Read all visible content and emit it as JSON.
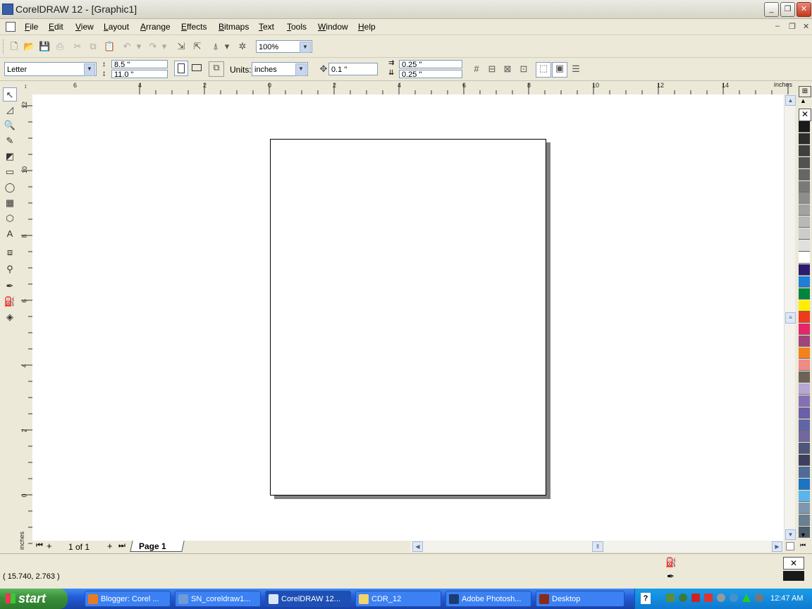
{
  "window": {
    "title": "CorelDRAW 12 - [Graphic1]"
  },
  "menu": [
    "File",
    "Edit",
    "View",
    "Layout",
    "Arrange",
    "Effects",
    "Bitmaps",
    "Text",
    "Tools",
    "Window",
    "Help"
  ],
  "toolbar": {
    "zoom": "100%"
  },
  "property_bar": {
    "paper": "Letter",
    "width": "8.5 \"",
    "height": "11.0 \"",
    "units_label": "Units:",
    "units": "inches",
    "nudge": "0.1 \"",
    "dup_x": "0.25 \"",
    "dup_y": "0.25 \""
  },
  "rulers": {
    "unit": "inches",
    "top_labels": [
      "6",
      "4",
      "2",
      "0",
      "2",
      "4",
      "6",
      "8",
      "10",
      "12",
      "14"
    ],
    "left_labels": [
      "12",
      "10",
      "8",
      "6",
      "4",
      "2",
      "0"
    ]
  },
  "page_nav": {
    "count": "1 of 1",
    "tab": "Page 1"
  },
  "status": {
    "coords": "( 15.740, 2.763 )"
  },
  "palette": [
    "#1a1a1a",
    "#2d2d2d",
    "#3f3f3f",
    "#525252",
    "#666666",
    "#7a7a7a",
    "#8e8e8e",
    "#a3a3a3",
    "#b8b8b8",
    "#cccccc",
    "#e0e0e0",
    "#ffffff",
    "#2e1a6e",
    "#1f7fd6",
    "#00853e",
    "#ffee00",
    "#ee3a1f",
    "#e4266a",
    "#a0457a",
    "#f2811e",
    "#ef8a86",
    "#6e6258",
    "#b6a6d2",
    "#8670b5",
    "#6a5fa8",
    "#5f66a6",
    "#72689f",
    "#4f567c",
    "#3e3f5e",
    "#4f6c98",
    "#1c74c4",
    "#58b6ec",
    "#7f96b0",
    "#6a7f92",
    "#4e5d6c"
  ],
  "taskbar": {
    "start": "start",
    "tasks": [
      "Blogger: Corel ...",
      "SN_coreldraw1...",
      "CorelDRAW 12...",
      "CDR_12",
      "Adobe Photosh...",
      "Desktop"
    ],
    "clock": "12:47 AM"
  }
}
